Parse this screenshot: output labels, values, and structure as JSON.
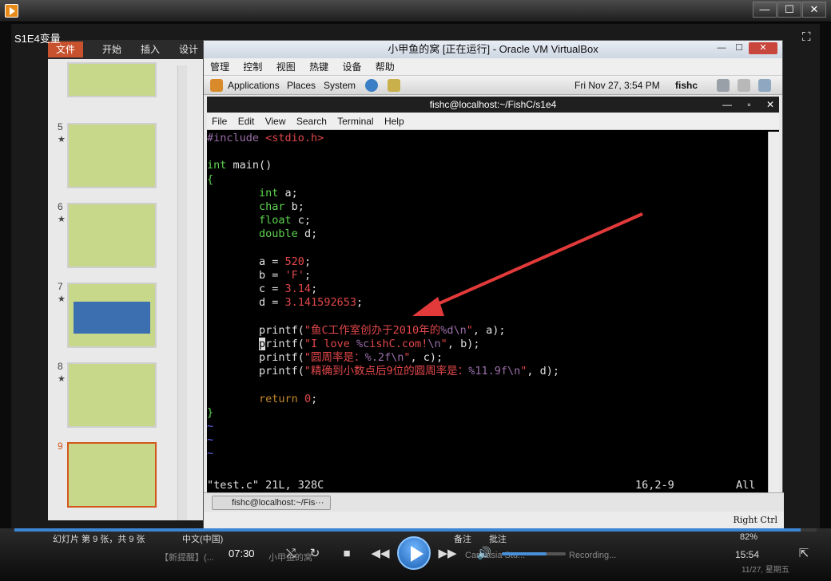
{
  "player": {
    "video_title": "S1E4变量",
    "time": "07:30",
    "progress_fraction": 0.98,
    "volume_fraction": 0.7
  },
  "ppt": {
    "tabs": [
      "文件",
      "开始",
      "插入",
      "设计"
    ],
    "slides": [
      {
        "num": "5",
        "star": "★"
      },
      {
        "num": "6",
        "star": "★"
      },
      {
        "num": "7",
        "star": "★"
      },
      {
        "num": "8",
        "star": "★"
      },
      {
        "num": "9",
        "star": ""
      }
    ],
    "status_slide": "幻灯片 第 9 张，共 9 张",
    "status_lang": "中文(中国)",
    "status_notes": "备注",
    "status_comments": "批注",
    "zoom": "82%"
  },
  "vbox": {
    "title": "小甲鱼的窝 [正在运行] - Oracle VM VirtualBox",
    "menu": [
      "管理",
      "控制",
      "视图",
      "热键",
      "设备",
      "帮助"
    ],
    "right_ctrl": "Right Ctrl"
  },
  "gnome": {
    "applications": "Applications",
    "places": "Places",
    "system": "System",
    "datetime": "Fri Nov 27,  3:54 PM",
    "user": "fishc",
    "task_label": "fishc@localhost:~/Fis···"
  },
  "terminal": {
    "title": "fishc@localhost:~/FishC/s1e4",
    "menu": [
      "File",
      "Edit",
      "View",
      "Search",
      "Terminal",
      "Help"
    ],
    "status_left": "\"test.c\" 21L, 328C",
    "status_pos": "16,2-9",
    "status_right": "All"
  },
  "taskbar": {
    "clock": "15:54",
    "date": "11/27, 星期五",
    "ghost_items": [
      "【新提醒】(...",
      "小甲鱼的窝",
      "Camtasia Stu...",
      "Recording..."
    ]
  },
  "colors": {
    "keyword": "#5dd44e",
    "preproc": "#9a6fa9",
    "string": "#e2474a",
    "func": "#c58a2d",
    "accent": "#3c86d4",
    "arrow": "#e23a3a"
  }
}
